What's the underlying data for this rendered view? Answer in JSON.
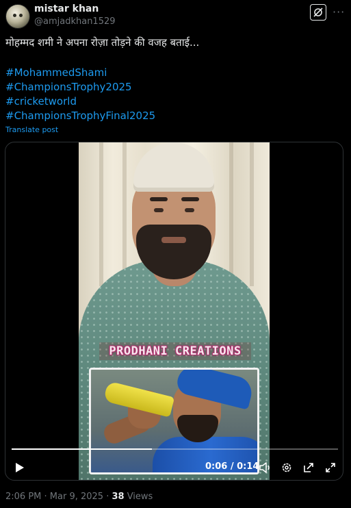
{
  "post": {
    "author_name": "mistar khan",
    "author_handle": "@amjadkhan1529",
    "text": "मोहम्मद शमी ने अपना रोज़ा तोड़ने की वजह बताई...",
    "hashtags": [
      "#MohammedShami",
      "#ChampionsTrophy2025",
      "#cricketworld",
      "#ChampionsTrophyFinal2025"
    ],
    "translate_label": "Translate post",
    "timestamp": "2:06 PM · Mar 9, 2025",
    "separator": " · ",
    "views_count": "38",
    "views_label": " Views"
  },
  "video": {
    "watermark": "PRODHANI CREATIONS",
    "current_time": "0:06",
    "duration": "0:14",
    "time_display": "0:06 / 0:14",
    "progress": 0.43
  },
  "icons": [
    "avatar",
    "grok-icon",
    "more-icon",
    "play-icon",
    "volume-icon",
    "settings-icon",
    "popout-icon",
    "fullscreen-icon"
  ],
  "colors": {
    "accent": "#1d9bf0",
    "background": "#000000",
    "text": "#e7e9ea",
    "muted": "#71767b"
  }
}
